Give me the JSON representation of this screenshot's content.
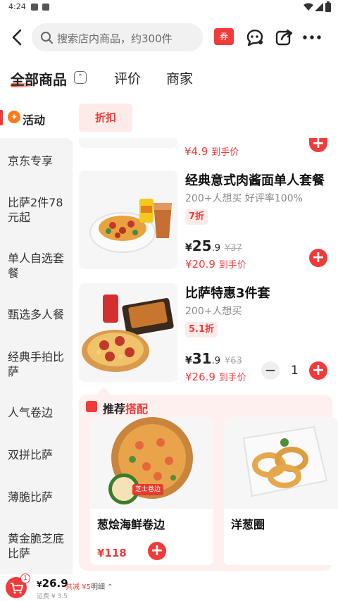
{
  "status_bar": {
    "time": "4:24"
  },
  "search": {
    "placeholder": "搜索店内商品，约300件"
  },
  "header": {
    "coupon_label": "券"
  },
  "tabs": [
    {
      "label": "全部商品"
    },
    {
      "label": "评价"
    },
    {
      "label": "商家"
    }
  ],
  "sidebar": {
    "active": {
      "label": "活动",
      "icon": "flame-icon"
    },
    "items": [
      {
        "label": "京东专享"
      },
      {
        "label": "比萨2件78元起"
      },
      {
        "label": "单人自选套餐"
      },
      {
        "label": "甄选多人餐"
      },
      {
        "label": "经典手拍比萨"
      },
      {
        "label": "人气卷边"
      },
      {
        "label": "双拼比萨"
      },
      {
        "label": "薄脆比萨"
      },
      {
        "label": "黄金脆芝底比萨"
      }
    ]
  },
  "filter_chip": {
    "label": "折扣"
  },
  "previous_item": {
    "price": "¥4.9",
    "suffix": "到手价"
  },
  "products": [
    {
      "name": "经典意式肉酱面单人套餐",
      "sales": "200+人想买 好评率100%",
      "discount_tag": "7折",
      "price_yen": "¥",
      "price_int": "25",
      "price_dec": ".9",
      "original_price": "¥37",
      "final_price": "¥20.9",
      "final_suffix": "到手价"
    },
    {
      "name": "比萨特惠3件套",
      "sales": "200+人想买",
      "discount_tag": "5.1折",
      "price_yen": "¥",
      "price_int": "31",
      "price_dec": ".9",
      "original_price": "¥63",
      "final_price": "¥26.9",
      "final_suffix": "到手价",
      "quantity": "1"
    }
  ],
  "recommend": {
    "title_prefix": "推荐",
    "title_highlight": "搭配",
    "items": [
      {
        "name": "葱烩海鲜卷边",
        "price": "¥118",
        "badge": "芝士卷边"
      },
      {
        "name": "洋葱圈"
      }
    ]
  },
  "cart": {
    "count": "1",
    "total_yen": "¥",
    "total_amount": "26.9",
    "saved": "共减 ¥5",
    "detail_label": "明细",
    "shipping": "运费 ¥ 3.5"
  },
  "colors": {
    "accent": "#ef3b3b",
    "tag_bg": "#fdebe9",
    "panel_bg": "#fdf0ee"
  }
}
